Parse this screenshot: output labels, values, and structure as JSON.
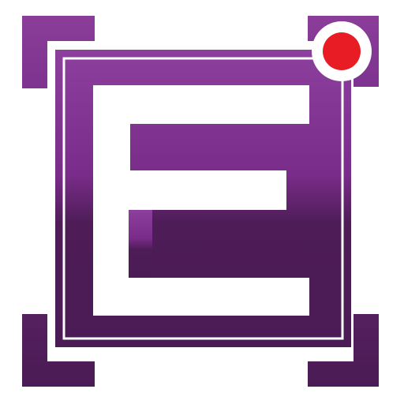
{
  "icon": {
    "name": "app-logo-icon",
    "letter_glyph": "E",
    "brand_color_top": "#8d3f9d",
    "brand_color_mid": "#7a2c8a",
    "brand_color_bottom": "#4e1d58",
    "letter_color": "#ffffff",
    "recording_dot_color": "#e81c24"
  }
}
